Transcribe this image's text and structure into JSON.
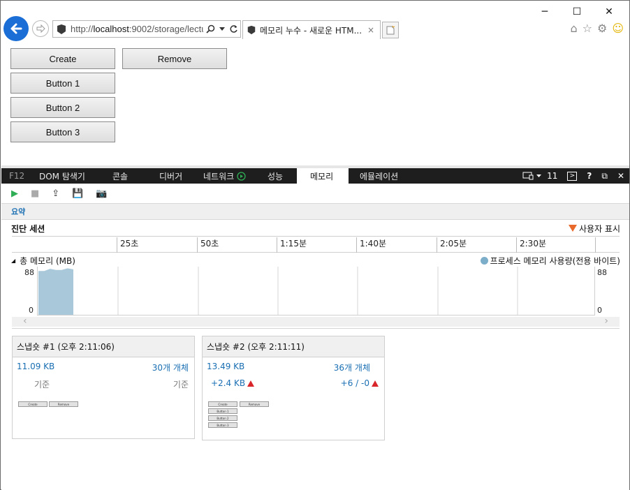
{
  "browser": {
    "url_prefix": "http://",
    "url_host": "localhost",
    "url_rest": ":9002/storage/lectu",
    "tab_title": "메모리 누수 - 새로운 HTM...",
    "tab_close": "×"
  },
  "window_controls": {
    "minimize": "─",
    "maximize": "☐",
    "close": "✕"
  },
  "page": {
    "buttons": {
      "create": "Create",
      "remove": "Remove",
      "button1": "Button 1",
      "button2": "Button 2",
      "button3": "Button 3"
    }
  },
  "devtools": {
    "tabs": [
      "F12",
      "DOM 탐색기",
      "콘솔",
      "디버거",
      "네트워크",
      "성능",
      "메모리",
      "에뮬레이션"
    ],
    "active_tab": "메모리",
    "target_count": "11",
    "help": "?",
    "summary_label": "요약",
    "session_title": "진단 세션",
    "user_marks": "사용자 표시",
    "ruler_labels": [
      "25초",
      "50초",
      "1:15분",
      "1:40분",
      "2:05분",
      "2:30분"
    ],
    "memory_title": "총 메모리 (MB)",
    "legend_label": "프로세스 메모리 사용량(전용 바이트)",
    "y_max": "88",
    "y_min": "0",
    "colors": {
      "accent_blue": "#1a6fb3",
      "series": "#a9c9db",
      "increase": "#d8262a",
      "user_mark": "#e8692b"
    }
  },
  "chart_data": {
    "type": "area",
    "title": "총 메모리 (MB)",
    "series": [
      {
        "name": "프로세스 메모리 사용량(전용 바이트)",
        "x": [
          0,
          1,
          2,
          3,
          4,
          5,
          6
        ],
        "values": [
          80,
          80,
          84,
          82,
          82,
          85,
          83
        ]
      }
    ],
    "ylim": [
      0,
      88
    ]
  },
  "snapshots": [
    {
      "title": "스냅숏 #1 (오후 2:11:06)",
      "size": "11.09 KB",
      "objects": "30개 개체",
      "size_delta": "기준",
      "objects_delta": "기준",
      "thumb_buttons": [
        "Create",
        "Remove"
      ]
    },
    {
      "title": "스냅숏 #2 (오후 2:11:11)",
      "size": "13.49 KB",
      "objects": "36개 개체",
      "size_delta": "+2.4 KB",
      "objects_delta": "+6 / -0",
      "thumb_buttons": [
        "Create",
        "Remove",
        "Button 1",
        "Button 2",
        "Button 3"
      ]
    }
  ]
}
